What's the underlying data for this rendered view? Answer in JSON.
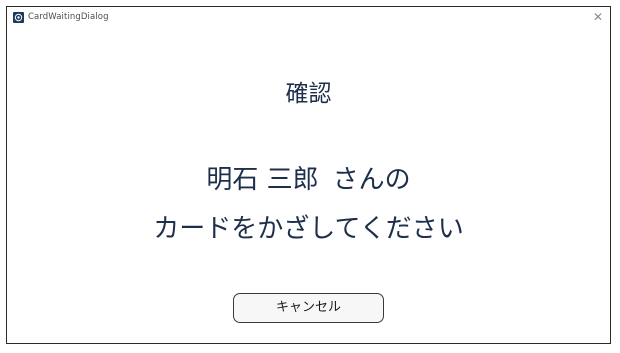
{
  "window": {
    "title": "CardWaitingDialog",
    "close_glyph": "✕",
    "icon": "app-icon"
  },
  "dialog": {
    "heading": "確認",
    "name": "明石 三郎",
    "name_suffix": "さんの",
    "instruction": "カードをかざしてください",
    "cancel_label": "キャンセル"
  },
  "colors": {
    "text_primary": "#1d2f4a",
    "icon_bg": "#1c3a5e"
  }
}
